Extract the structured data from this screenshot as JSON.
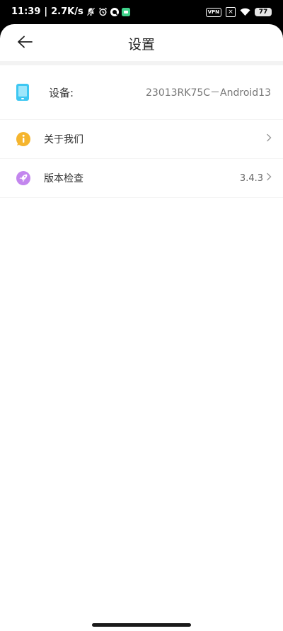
{
  "status_bar": {
    "time": "11:39",
    "separator": "|",
    "net_speed": "2.7K/s",
    "vpn_label": "VPN",
    "battery": "77"
  },
  "header": {
    "title": "设置"
  },
  "device": {
    "label": "设备:",
    "value": "23013RK75C－Android13"
  },
  "menu": [
    {
      "label": "关于我们",
      "value": ""
    },
    {
      "label": "版本检查",
      "value": "3.4.3"
    }
  ],
  "colors": {
    "device_icon": "#3ec7f2",
    "about_icon": "#f5b52e",
    "version_icon": "#b066e0"
  }
}
